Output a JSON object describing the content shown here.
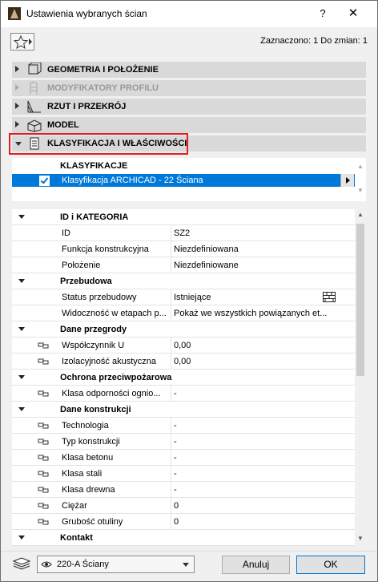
{
  "window": {
    "title": "Ustawienia wybranych ścian",
    "help_label": "?",
    "close_label": "✕"
  },
  "selection_info": "Zaznaczono: 1 Do zmian: 1",
  "sections": [
    {
      "label": "GEOMETRIA I POŁOŻENIE",
      "expanded": false,
      "enabled": true,
      "icon": "wall-geometry-icon"
    },
    {
      "label": "MODYFIKATORY PROFILU",
      "expanded": false,
      "enabled": false,
      "icon": "profile-modifier-icon"
    },
    {
      "label": "RZUT I PRZEKRÓJ",
      "expanded": false,
      "enabled": true,
      "icon": "floor-plan-section-icon"
    },
    {
      "label": "MODEL",
      "expanded": false,
      "enabled": true,
      "icon": "model-box-icon"
    },
    {
      "label": "KLASYFIKACJA I WŁAŚCIWOŚCI",
      "expanded": true,
      "enabled": true,
      "icon": "document-icon"
    }
  ],
  "classification": {
    "header": "KLASYFIKACJE",
    "row_label": "Klasyfikacja ARCHICAD - 22 Ściana",
    "checked": true
  },
  "properties": [
    {
      "type": "group",
      "name": "ID i KATEGORIA"
    },
    {
      "type": "prop",
      "name": "ID",
      "value": "SZ2",
      "linked": false
    },
    {
      "type": "prop",
      "name": "Funkcja konstrukcyjna",
      "value": "Niezdefiniowana",
      "linked": false
    },
    {
      "type": "prop",
      "name": "Położenie",
      "value": "Niezdefiniowane",
      "linked": false
    },
    {
      "type": "group",
      "name": "Przebudowa"
    },
    {
      "type": "prop",
      "name": "Status przebudowy",
      "value": "Istniejące",
      "linked": false,
      "icon": "brick-icon"
    },
    {
      "type": "prop",
      "name": "Widoczność w etapach p...",
      "value": "Pokaż we wszystkich powiązanych et...",
      "linked": false
    },
    {
      "type": "group",
      "name": "Dane przegrody"
    },
    {
      "type": "prop",
      "name": "Współczynnik U",
      "value": "0,00",
      "linked": true
    },
    {
      "type": "prop",
      "name": "Izolacyjność akustyczna",
      "value": "0,00",
      "linked": true
    },
    {
      "type": "group",
      "name": "Ochrona przeciwpożarowa"
    },
    {
      "type": "prop",
      "name": "Klasa odporności ognio...",
      "value": "-",
      "linked": true
    },
    {
      "type": "group",
      "name": "Dane konstrukcji"
    },
    {
      "type": "prop",
      "name": "Technologia",
      "value": "-",
      "linked": true
    },
    {
      "type": "prop",
      "name": "Typ konstrukcji",
      "value": "-",
      "linked": true
    },
    {
      "type": "prop",
      "name": "Klasa betonu",
      "value": "-",
      "linked": true
    },
    {
      "type": "prop",
      "name": "Klasa stali",
      "value": "-",
      "linked": true
    },
    {
      "type": "prop",
      "name": "Klasa drewna",
      "value": "-",
      "linked": true
    },
    {
      "type": "prop",
      "name": "Ciężar",
      "value": "0",
      "linked": true
    },
    {
      "type": "prop",
      "name": "Grubość otuliny",
      "value": "0",
      "linked": true
    },
    {
      "type": "group",
      "name": "Kontakt"
    }
  ],
  "footer": {
    "layer": "220-A Ściany",
    "cancel_label": "Anuluj",
    "ok_label": "OK"
  },
  "colors": {
    "selection": "#0078d7",
    "highlight_box": "#e02020",
    "section_bar": "#d9d9d9"
  }
}
